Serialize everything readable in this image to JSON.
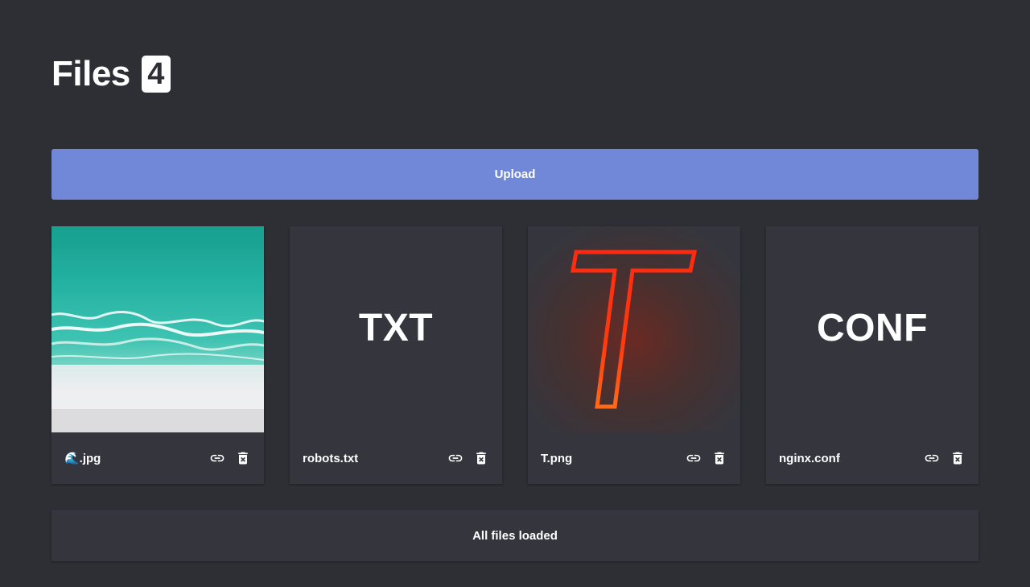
{
  "header": {
    "title": "Files",
    "count": "4"
  },
  "upload": {
    "label": "Upload",
    "color": "#7188d8"
  },
  "files": [
    {
      "name": "🌊.jpg",
      "preview": "image",
      "preview_icon": "beach-image"
    },
    {
      "name": "robots.txt",
      "preview": "text",
      "ext_label": "TXT"
    },
    {
      "name": "T.png",
      "preview": "image",
      "preview_icon": "neon-t-image"
    },
    {
      "name": "nginx.conf",
      "preview": "text",
      "ext_label": "CONF"
    }
  ],
  "actions": {
    "link_icon": "link-icon",
    "delete_icon": "trash-icon"
  },
  "status": {
    "text": "All files loaded"
  },
  "colors": {
    "background": "#2e2f35",
    "card": "#35363d",
    "accent": "#7188d8",
    "neon": "#ff3a10"
  }
}
